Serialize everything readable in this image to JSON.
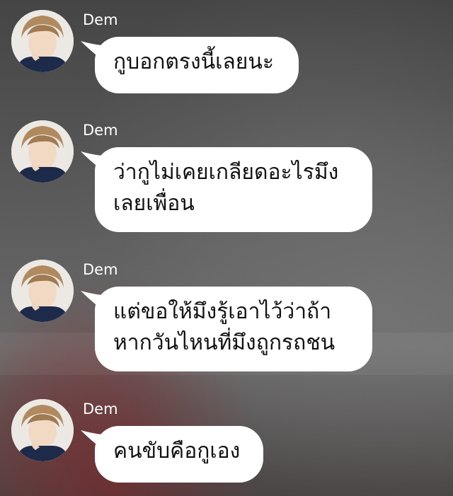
{
  "chat": {
    "messages": [
      {
        "sender": "Dem",
        "lines": [
          "กูบอกตรงนี้เลยนะ"
        ]
      },
      {
        "sender": "Dem",
        "lines": [
          "ว่ากูไม่เคยเกลียดอะไรมึง",
          "เลยเพื่อน"
        ]
      },
      {
        "sender": "Dem",
        "lines": [
          "แต่ขอให้มึงรู้เอาไว้ว่าถ้า",
          "หากวันไหนที่มึงถูกรถชน"
        ]
      },
      {
        "sender": "Dem",
        "lines": [
          "คนขับคือกูเอง"
        ]
      }
    ]
  },
  "colors": {
    "bubble": "#ffffff",
    "text": "#111111",
    "name": "#ffffff",
    "background": "#555555"
  }
}
